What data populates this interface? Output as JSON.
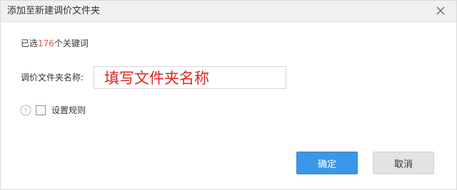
{
  "dialog": {
    "title": "添加至新建调价文件夹",
    "close_icon": "close-icon"
  },
  "selection": {
    "prefix": "已选",
    "count": "176",
    "suffix": "个关键词"
  },
  "folder_name": {
    "label": "调价文件夹名称:",
    "value": "填写文件夹名称"
  },
  "rules": {
    "help_icon": "question-circle-icon",
    "checked": false,
    "label": "设置规则"
  },
  "buttons": {
    "ok_label": "确定",
    "cancel_label": "取消"
  },
  "colors": {
    "primary_button": "#3b97e8",
    "count_highlight": "#e2564f",
    "input_text": "#e0251c"
  }
}
